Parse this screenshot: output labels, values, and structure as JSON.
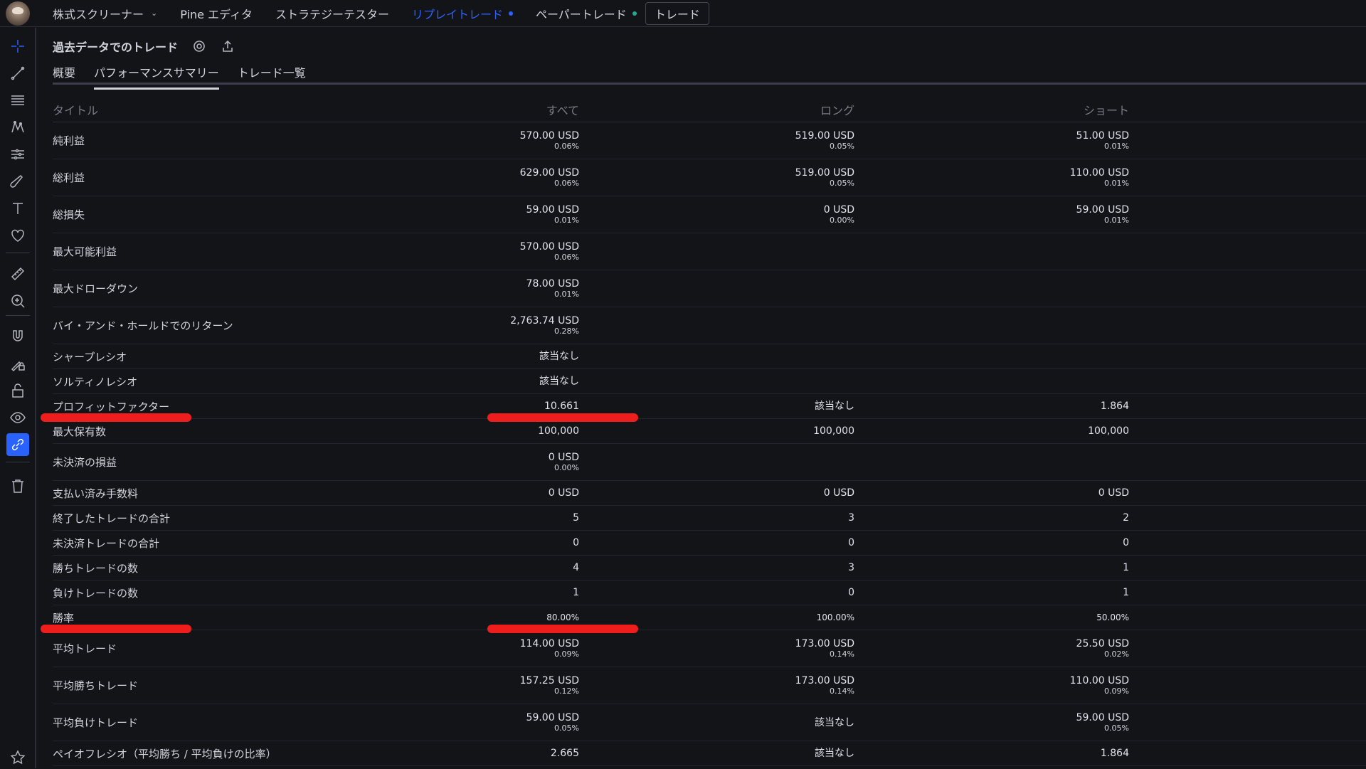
{
  "topnav": {
    "items": [
      {
        "label": "株式スクリーナー",
        "dropdown": true,
        "active": false,
        "dot": null
      },
      {
        "label": "Pine エディタ",
        "dropdown": false,
        "active": false,
        "dot": null
      },
      {
        "label": "ストラテジーテスター",
        "dropdown": false,
        "active": false,
        "dot": null
      },
      {
        "label": "リプレイトレード",
        "dropdown": false,
        "active": true,
        "dot": "blue"
      },
      {
        "label": "ペーパートレード",
        "dropdown": false,
        "active": false,
        "dot": "green"
      }
    ],
    "trade_button": "トレード"
  },
  "sidebar": {
    "icons": [
      "crosshair-icon",
      "trend-line-icon",
      "fib-lines-icon",
      "pattern-icon",
      "forecast-icon",
      "brush-icon",
      "text-icon",
      "heart-icon",
      "ruler-icon",
      "zoom-in-icon",
      "magnet-icon",
      "lock-drawing-icon",
      "lock-icon",
      "eye-icon",
      "link-icon",
      "trash-icon",
      "star-icon"
    ],
    "active_icon": "link-icon"
  },
  "panel": {
    "title": "過去データでのトレード",
    "tabs": [
      "概要",
      "パフォーマンスサマリー",
      "トレード一覧"
    ],
    "active_tab": 1
  },
  "table": {
    "headers": {
      "title": "タイトル",
      "all": "すべて",
      "long": "ロング",
      "short": "ショート"
    },
    "rows": [
      {
        "title": "純利益",
        "all": "570.00 USD",
        "all_sub": "0.06%",
        "long": "519.00 USD",
        "long_sub": "0.05%",
        "short": "51.00 USD",
        "short_sub": "0.01%"
      },
      {
        "title": "総利益",
        "all": "629.00 USD",
        "all_sub": "0.06%",
        "long": "519.00 USD",
        "long_sub": "0.05%",
        "short": "110.00 USD",
        "short_sub": "0.01%"
      },
      {
        "title": "総損失",
        "all": "59.00 USD",
        "all_sub": "0.01%",
        "long": "0 USD",
        "long_sub": "0.00%",
        "short": "59.00 USD",
        "short_sub": "0.01%"
      },
      {
        "title": "最大可能利益",
        "all": "570.00 USD",
        "all_sub": "0.06%",
        "long": "",
        "long_sub": "",
        "short": "",
        "short_sub": ""
      },
      {
        "title": "最大ドローダウン",
        "all": "78.00 USD",
        "all_sub": "0.01%",
        "long": "",
        "long_sub": "",
        "short": "",
        "short_sub": ""
      },
      {
        "title": "バイ・アンド・ホールドでのリターン",
        "all": "2,763.74 USD",
        "all_sub": "0.28%",
        "long": "",
        "long_sub": "",
        "short": "",
        "short_sub": ""
      },
      {
        "title": "シャープレシオ",
        "all": "該当なし",
        "all_sub": "",
        "long": "",
        "long_sub": "",
        "short": "",
        "short_sub": ""
      },
      {
        "title": "ソルティノレシオ",
        "all": "該当なし",
        "all_sub": "",
        "long": "",
        "long_sub": "",
        "short": "",
        "short_sub": ""
      },
      {
        "title": "プロフィットファクター",
        "all": "10.661",
        "all_sub": "",
        "long": "該当なし",
        "long_sub": "",
        "short": "1.864",
        "short_sub": ""
      },
      {
        "title": "最大保有数",
        "all": "100,000",
        "all_sub": "",
        "long": "100,000",
        "long_sub": "",
        "short": "100,000",
        "short_sub": ""
      },
      {
        "title": "未決済の損益",
        "all": "0 USD",
        "all_sub": "0.00%",
        "long": "",
        "long_sub": "",
        "short": "",
        "short_sub": ""
      },
      {
        "title": "支払い済み手数料",
        "all": "0 USD",
        "all_sub": "",
        "long": "0 USD",
        "long_sub": "",
        "short": "0 USD",
        "short_sub": ""
      },
      {
        "title": "終了したトレードの合計",
        "all": "5",
        "all_sub": "",
        "long": "3",
        "long_sub": "",
        "short": "2",
        "short_sub": ""
      },
      {
        "title": "未決済トレードの合計",
        "all": "0",
        "all_sub": "",
        "long": "0",
        "long_sub": "",
        "short": "0",
        "short_sub": ""
      },
      {
        "title": "勝ちトレードの数",
        "all": "4",
        "all_sub": "",
        "long": "3",
        "long_sub": "",
        "short": "1",
        "short_sub": ""
      },
      {
        "title": "負けトレードの数",
        "all": "1",
        "all_sub": "",
        "long": "0",
        "long_sub": "",
        "short": "1",
        "short_sub": ""
      },
      {
        "title": "勝率",
        "all": "80.00%",
        "all_sub": "",
        "long": "100.00%",
        "long_sub": "",
        "short": "50.00%",
        "short_sub": "",
        "small": true
      },
      {
        "title": "平均トレード",
        "all": "114.00 USD",
        "all_sub": "0.09%",
        "long": "173.00 USD",
        "long_sub": "0.14%",
        "short": "25.50 USD",
        "short_sub": "0.02%"
      },
      {
        "title": "平均勝ちトレード",
        "all": "157.25 USD",
        "all_sub": "0.12%",
        "long": "173.00 USD",
        "long_sub": "0.14%",
        "short": "110.00 USD",
        "short_sub": "0.09%"
      },
      {
        "title": "平均負けトレード",
        "all": "59.00 USD",
        "all_sub": "0.05%",
        "long": "該当なし",
        "long_sub": "",
        "short": "59.00 USD",
        "short_sub": "0.05%"
      },
      {
        "title": "ペイオフレシオ（平均勝ち / 平均負けの比率）",
        "all": "2.665",
        "all_sub": "",
        "long": "該当なし",
        "long_sub": "",
        "short": "1.864",
        "short_sub": ""
      }
    ]
  },
  "annotations": {
    "color": "#f01d1d",
    "highlighted_rows": [
      "プロフィットファクター",
      "勝率"
    ]
  },
  "colors": {
    "accent": "#2962ff",
    "background": "#131418",
    "text": "#d1d4dc",
    "muted": "#787b86"
  }
}
